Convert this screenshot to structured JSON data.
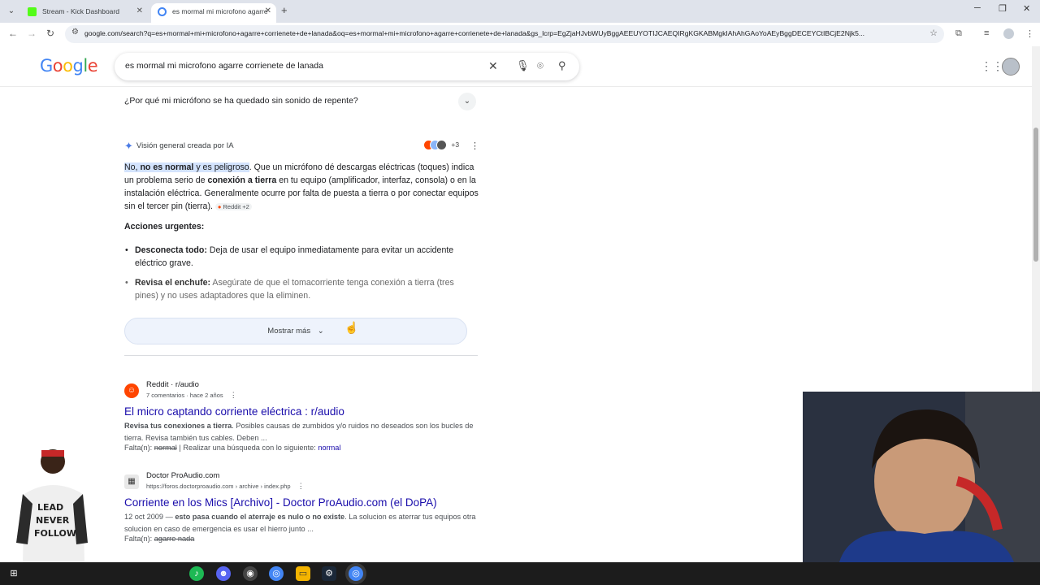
{
  "browser": {
    "tabs": [
      {
        "label": "Stream - Kick Dashboard",
        "favicon_color": "#53fc18",
        "active": false
      },
      {
        "label": "es mormal mi microfono agarre",
        "favicon_color": "#4285f4",
        "active": true
      }
    ],
    "url": "google.com/search?q=es+mormal+mi+microfono+agarre+corrienete+de+lanada&oq=es+mormal+mi+microfono+agarre+corrienete+de+lanada&gs_lcrp=EgZjaHJvbWUyBggAEEUYOTIJCAEQIRgKGKABMgkIAhAhGAoYoAEyBggDECEYCtIBCjE2Njk5..."
  },
  "google": {
    "logo": "Google",
    "query": "es mormal mi microfono agarre corrienete de lanada"
  },
  "faq": {
    "question": "¿Por qué mi micrófono se ha quedado sin sonido de repente?"
  },
  "ai_overview": {
    "header": "Visión general creada por IA",
    "sources_more": "+3",
    "p1_a": "No, ",
    "p1_b": "no es normal",
    "p1_c": " y es peligroso",
    "p1_d": ". Que un micrófono dé descargas eléctricas (toques) indica un problema serio de ",
    "p1_e": "conexión a tierra",
    "p1_f": " en tu equipo (amplificador, interfaz, consola) o en la instalación eléctrica. Generalmente ocurre por falta de puesta a tierra o por conectar equipos sin el tercer pin (tierra). ",
    "p1_cite": "Reddit +2",
    "acciones": "Acciones urgentes:",
    "b1_bold": "Desconecta todo:",
    "b1_text": " Deja de usar el equipo inmediatamente para evitar un accidente eléctrico grave.",
    "b2_bold": "Revisa el enchufe:",
    "b2_text": " Asegúrate de que el tomacorriente tenga conexión a tierra (tres pines) y no uses adaptadores que la eliminen.",
    "show_more": "Mostrar más"
  },
  "results": [
    {
      "site": "Reddit · r/audio",
      "meta": "7 comentarios · hace 2 años",
      "title": "El micro captando corriente eléctrica : r/audio",
      "snip_bold": "Revisa tus conexiones a tierra",
      "snip_text": ". Posibles causas de zumbidos y/o ruidos no deseados son los bucles de tierra. Revisa también tus cables. Deben ...",
      "missing_label": "Falta(n): ",
      "missing_word": "normal",
      "missing_sep": " | Realizar una búsqueda con lo siguiente: ",
      "missing_link": "normal"
    },
    {
      "site": "Doctor ProAudio.com",
      "meta": "https://foros.doctorproaudio.com › archive › index.php",
      "title": "Corriente en los Mics [Archivo] - Doctor ProAudio.com (el DoPA)",
      "snip_pre": "12 oct 2009 — ",
      "snip_bold": "esto pasa cuando el aterraje es nulo o no existe",
      "snip_text": ". La solucion es aterrar tus equipos otra solucion en caso de emergencia es usar el hierro junto ...",
      "missing_label": "Falta(n): ",
      "missing_word": "agarre nada"
    }
  ]
}
